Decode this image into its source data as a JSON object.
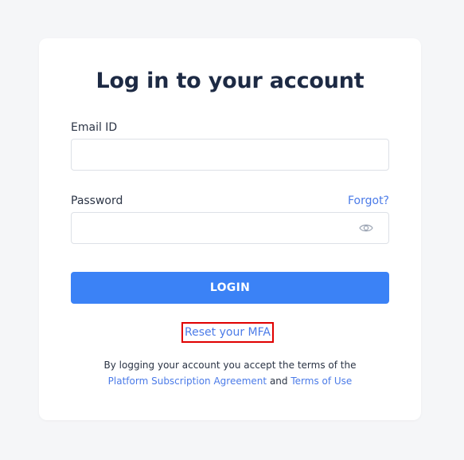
{
  "login": {
    "title": "Log in to your account",
    "email_label": "Email ID",
    "email_value": "",
    "password_label": "Password",
    "password_value": "",
    "forgot_label": "Forgot?",
    "login_button": "LOGIN",
    "reset_mfa_label": "Reset your MFA",
    "terms_prefix": "By logging your account you accept the terms of the",
    "terms_link_1": "Platform Subscription Agreement",
    "terms_conjunction": "and",
    "terms_link_2": "Terms of Use"
  },
  "icons": {
    "password_toggle": "eye-icon"
  },
  "colors": {
    "background": "#f5f6f8",
    "card": "#ffffff",
    "title": "#1d2a44",
    "link": "#4b7be8",
    "primary": "#3b82f6",
    "highlight_border": "#e00000"
  }
}
